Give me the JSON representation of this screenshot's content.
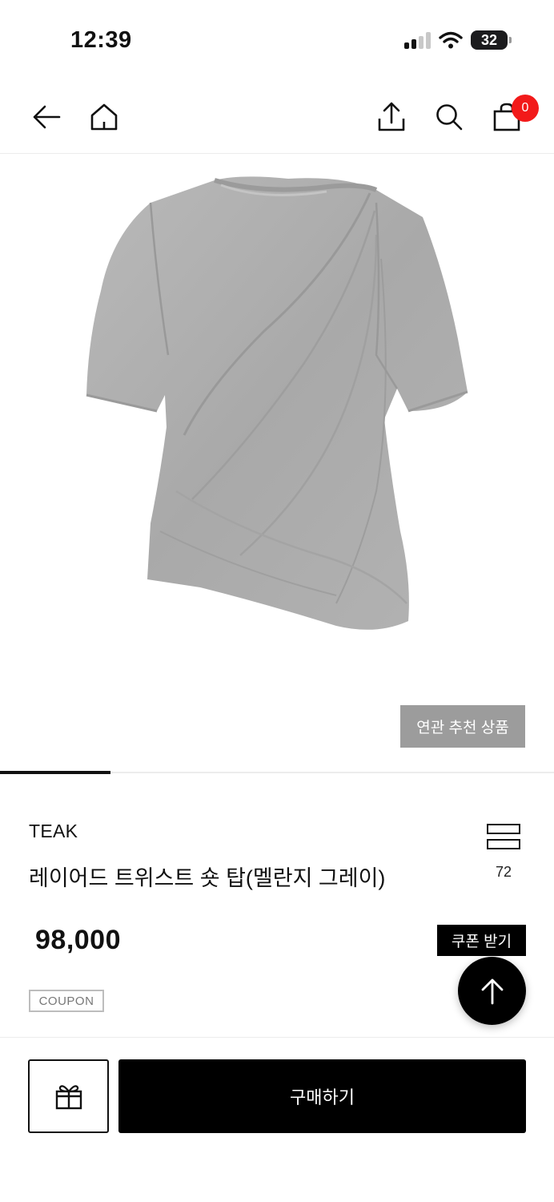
{
  "status_bar": {
    "time": "12:39",
    "battery": "32"
  },
  "nav": {
    "cart_count": "0"
  },
  "related_button": "연관 추천 상품",
  "image_slider": {
    "current": 1,
    "total": 5
  },
  "product": {
    "brand": "TEAK",
    "name": "레이어드 트위스트 숏 탑(멜란지 그레이)",
    "view_count": "72",
    "price": "98,000",
    "coupon_button": "쿠폰 받기",
    "coupon_tag": "COUPON"
  },
  "bottom": {
    "buy_label": "구매하기"
  }
}
